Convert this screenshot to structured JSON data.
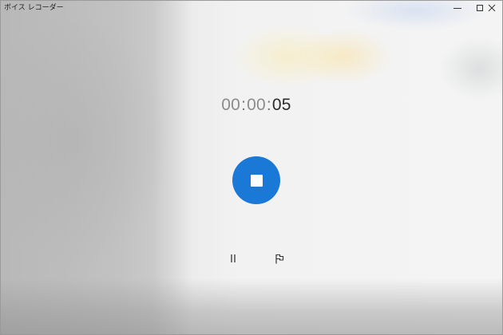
{
  "window": {
    "title": "ボイス レコーダー",
    "controls": [
      "minimize-icon",
      "maximize-icon",
      "close-icon"
    ]
  },
  "recorder": {
    "timer": {
      "hours": "00",
      "separator1": ":",
      "minutes": "00",
      "separator2": ":",
      "seconds": "05"
    },
    "stop_button": {
      "icon": "stop-icon",
      "color": "#1a78d7"
    },
    "pause_button": {
      "icon": "pause-icon"
    },
    "marker_button": {
      "icon": "flag-icon"
    }
  }
}
